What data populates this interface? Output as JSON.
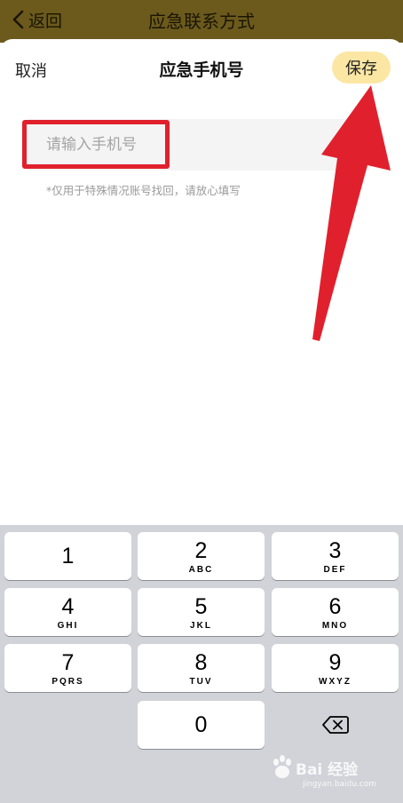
{
  "topbar": {
    "back_label": "返回",
    "title": "应急联系方式"
  },
  "sheet": {
    "cancel_label": "取消",
    "title": "应急手机号",
    "save_label": "保存"
  },
  "phone_input": {
    "placeholder": "请输入手机号",
    "value": ""
  },
  "hint": "*仅用于特殊情况账号找回，请放心填写",
  "keyboard": {
    "keys": [
      {
        "num": "1",
        "letters": ""
      },
      {
        "num": "2",
        "letters": "ABC"
      },
      {
        "num": "3",
        "letters": "DEF"
      },
      {
        "num": "4",
        "letters": "GHI"
      },
      {
        "num": "5",
        "letters": "JKL"
      },
      {
        "num": "6",
        "letters": "MNO"
      },
      {
        "num": "7",
        "letters": "PQRS"
      },
      {
        "num": "8",
        "letters": "TUV"
      },
      {
        "num": "9",
        "letters": "WXYZ"
      },
      {
        "num": "0",
        "letters": ""
      }
    ]
  },
  "watermark": {
    "brand": "Bai 经验",
    "url": "jingyan.baidu.com"
  },
  "colors": {
    "topbar": "#6b5a1c",
    "save_button": "#fbe7a3",
    "annotation_red": "#e0212d",
    "keyboard_bg": "#d1d3d9"
  },
  "icons": {
    "back": "chevron-left-icon",
    "delete": "backspace-icon",
    "annotation": "red-arrow"
  }
}
